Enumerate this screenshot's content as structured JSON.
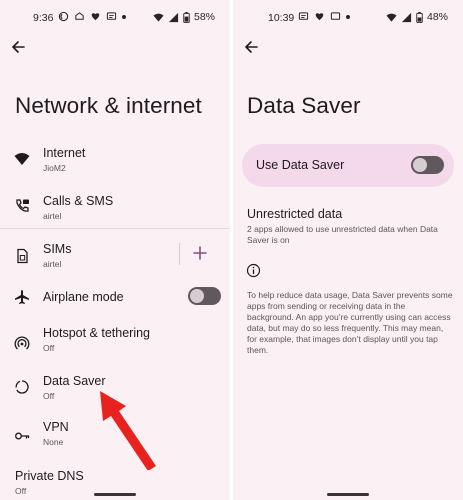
{
  "left_screen": {
    "status": {
      "time": "9:36",
      "battery": "58%"
    },
    "title": "Network & internet",
    "items": [
      {
        "title": "Internet",
        "subtitle": "JioM2",
        "icon": "wifi-icon"
      },
      {
        "title": "Calls & SMS",
        "subtitle": "airtel",
        "icon": "calls-sms-icon"
      },
      {
        "title": "SIMs",
        "subtitle": "airtel",
        "icon": "sim-icon"
      },
      {
        "title": "Airplane mode",
        "subtitle": "",
        "icon": "airplane-icon",
        "toggle_on": false
      },
      {
        "title": "Hotspot & tethering",
        "subtitle": "Off",
        "icon": "hotspot-icon"
      },
      {
        "title": "Data Saver",
        "subtitle": "Off",
        "icon": "data-saver-icon"
      },
      {
        "title": "VPN",
        "subtitle": "None",
        "icon": "vpn-key-icon"
      },
      {
        "title": "Private DNS",
        "subtitle": "Off",
        "icon": ""
      }
    ],
    "annotation_arrow_color": "#e8231f"
  },
  "right_screen": {
    "status": {
      "time": "10:39",
      "battery": "48%"
    },
    "title": "Data Saver",
    "use_data_saver": {
      "label": "Use Data Saver",
      "toggle_on": false
    },
    "unrestricted": {
      "title": "Unrestricted data",
      "subtitle": "2 apps allowed to use unrestricted data when Data Saver is on"
    },
    "info_text": "To help reduce data usage, Data Saver prevents some apps from sending or receiving data in the background. An app you’re currently using can access data, but may do so less frequently. This may mean, for example, that images don’t display until you tap them."
  },
  "colors": {
    "panel_bg": "#fbf1f5",
    "pill_bg": "#f4d9ea",
    "toggle_off": "#5f585c",
    "add_accent": "#8a4f7a"
  }
}
